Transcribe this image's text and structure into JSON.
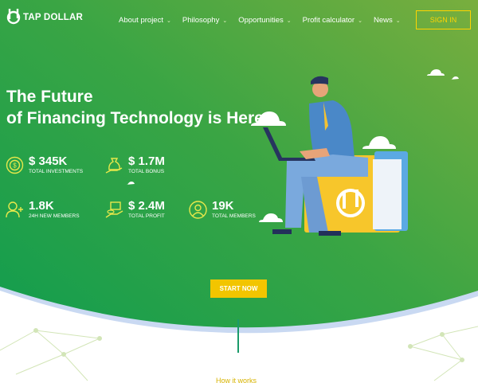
{
  "brand": {
    "name": "TAP DOLLAR",
    "logo_icon": "td-logo-icon"
  },
  "nav": {
    "items": [
      {
        "label": "About project"
      },
      {
        "label": "Philosophy"
      },
      {
        "label": "Opportunities"
      },
      {
        "label": "Profit calculator"
      },
      {
        "label": "News"
      }
    ],
    "sign_in_label": "SIGN IN"
  },
  "hero": {
    "headline_line1": "The Future",
    "headline_line2": "of Financing Technology is Here.",
    "cta_label": "START NOW"
  },
  "stats": [
    {
      "value": "$ 345K",
      "label": "TOTAL INVESTMENTS",
      "icon": "coin-stack-icon"
    },
    {
      "value": "$ 1.7M",
      "label": "TOTAL BONUS",
      "icon": "money-bag-hand-icon"
    },
    {
      "value": "1.8K",
      "label": "24H NEW MEMBERS",
      "icon": "add-user-icon"
    },
    {
      "value": "$ 2.4M",
      "label": "TOTAL PROFIT",
      "icon": "hand-coins-icon"
    },
    {
      "value": "19K",
      "label": "TOTAL MEMBERS",
      "icon": "user-circle-icon"
    }
  ],
  "section_preview": {
    "title": "How it works"
  },
  "colors": {
    "green_dark": "#10a04e",
    "green_light": "#6aac3e",
    "accent_yellow": "#f2c500",
    "white": "#ffffff"
  }
}
